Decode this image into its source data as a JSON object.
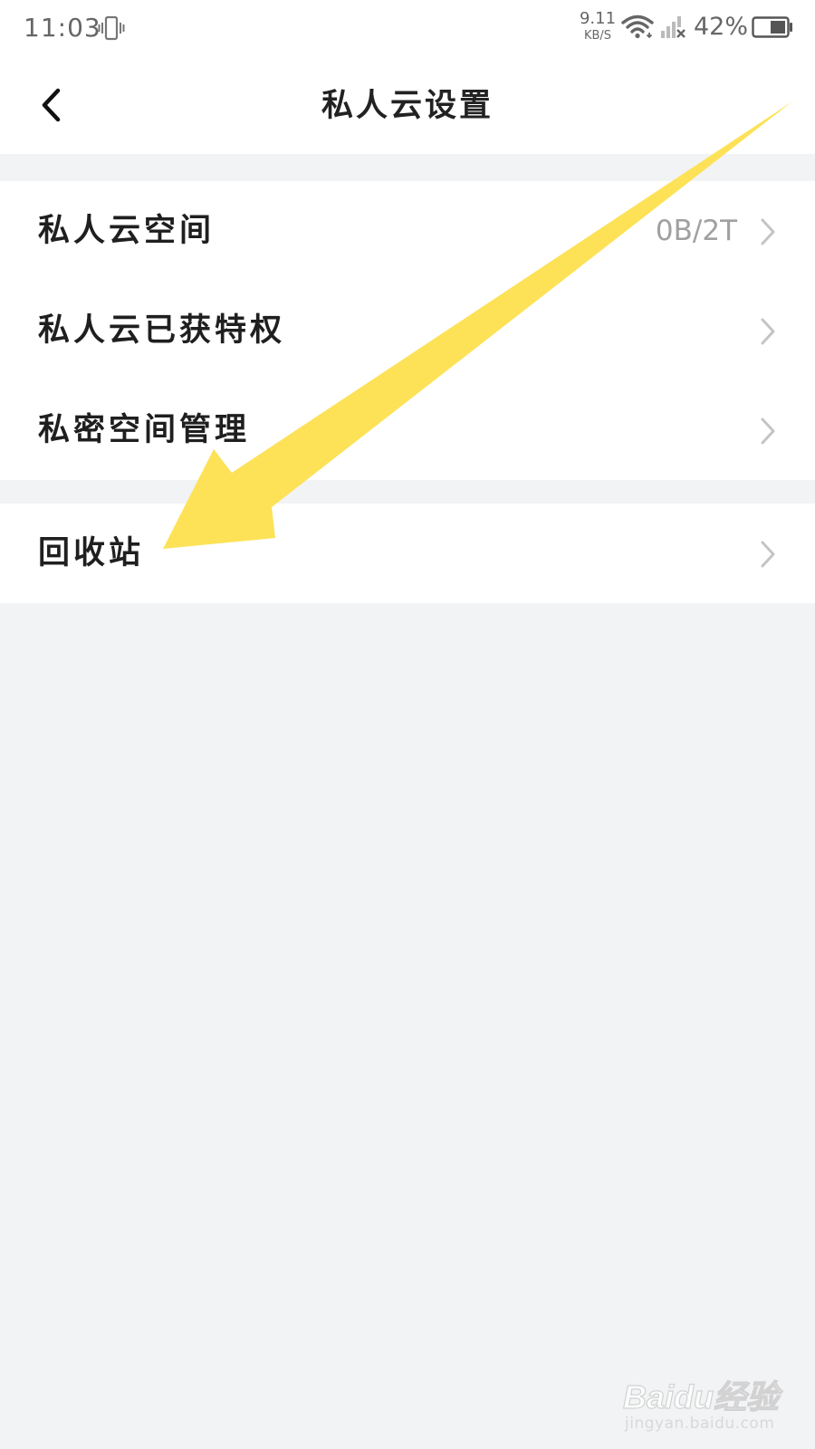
{
  "status_bar": {
    "time": "11:03",
    "net_speed_value": "9.11",
    "net_speed_unit": "KB/S",
    "battery_percent": "42%",
    "icons": [
      "vibrate-icon",
      "wifi-icon",
      "signal-icon",
      "battery-icon"
    ]
  },
  "header": {
    "title": "私人云设置",
    "back_icon": "chevron-left-icon"
  },
  "groups": [
    {
      "items": [
        {
          "label": "私人云空间",
          "value": "0B/2T"
        },
        {
          "label": "私人云已获特权",
          "value": ""
        },
        {
          "label": "私密空间管理",
          "value": ""
        }
      ]
    },
    {
      "items": [
        {
          "label": "回收站",
          "value": ""
        }
      ]
    }
  ],
  "annotation": {
    "color": "#fde257",
    "type": "arrow"
  },
  "watermark": {
    "logo": "Baidu经验",
    "url": "jingyan.baidu.com"
  },
  "colors": {
    "background": "#f2f3f5",
    "surface": "#ffffff",
    "text_primary": "#1f1f1f",
    "text_secondary": "#a0a0a0",
    "chevron": "#c4c4c4"
  }
}
